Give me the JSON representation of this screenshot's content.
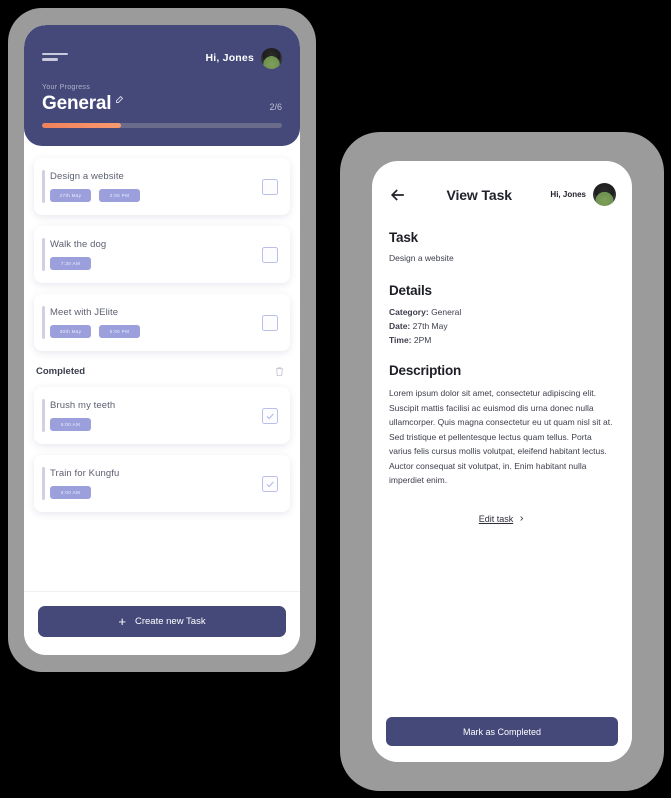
{
  "colors": {
    "brand_navy": "#44497a",
    "accent_orange": "#f0815a",
    "tag_periwinkle": "#9ba0dd",
    "device_frame": "#9b9b9b",
    "page_background": "#000000"
  },
  "home_screen": {
    "menu_icon": "hamburger-icon",
    "greeting": "Hi, Jones",
    "avatar": "user-avatar",
    "progress_label": "Your Progress",
    "category_name": "General",
    "edit_category_icon": "edit-pencil-icon",
    "progress_fraction": "2/6",
    "progress_percent": 33,
    "tasks": [
      {
        "title": "Design a website",
        "tags": [
          "27th May",
          "2:00 PM"
        ],
        "checked": false
      },
      {
        "title": "Walk the dog",
        "tags": [
          "7:30 AM"
        ],
        "checked": false
      },
      {
        "title": "Meet with JElite",
        "tags": [
          "30th May",
          "5:00 PM"
        ],
        "checked": false
      }
    ],
    "completed_header": "Completed",
    "delete_icon": "trash-icon",
    "completed_tasks": [
      {
        "title": "Brush my teeth",
        "tags": [
          "5:00 AM"
        ],
        "checked": true
      },
      {
        "title": "Train for Kungfu",
        "tags": [
          "6:00 AM"
        ],
        "checked": true
      }
    ],
    "create_button": {
      "icon": "plus-icon",
      "label": "Create new  Task"
    }
  },
  "detail_screen": {
    "back_icon": "arrow-left-icon",
    "title": "View Task",
    "greeting": "Hi, Jones",
    "avatar": "user-avatar",
    "task_heading": "Task",
    "task_name": "Design a website",
    "details_heading": "Details",
    "details": {
      "category_key": "Category:",
      "category_value": "General",
      "date_key": "Date:",
      "date_value": "27th May",
      "time_key": "Time:",
      "time_value": "2PM"
    },
    "description_heading": "Description",
    "description_text": "Lorem ipsum dolor sit amet, consectetur adipiscing elit. Suscipit mattis facilisi ac euismod dis urna donec nulla ullamcorper. Quis magna consectetur eu ut quam nisl sit at. Sed tristique et pellentesque lectus quam tellus. Porta varius felis cursus mollis volutpat, eleifend habitant lectus. Auctor consequat sit volutpat, in. Enim habitant nulla imperdiet enim.",
    "edit_link_label": "Edit task",
    "edit_link_icon": "chevron-right-icon",
    "mark_button_label": "Mark as Completed"
  }
}
